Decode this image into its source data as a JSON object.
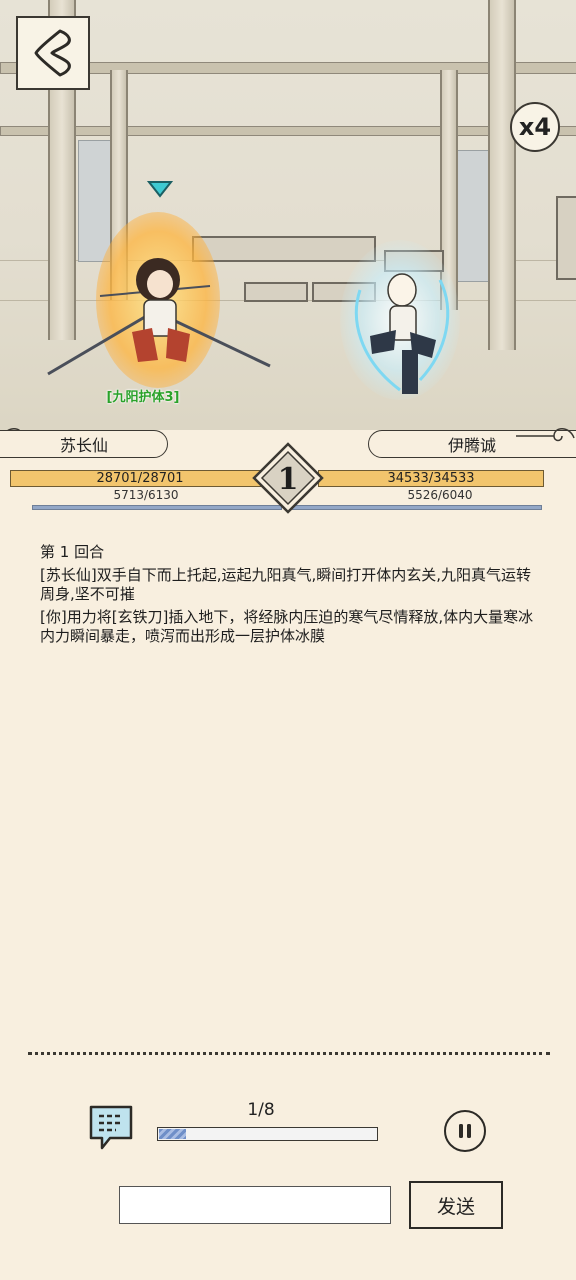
{
  "scene": {
    "speed_label": "x4",
    "player_buff": "[九阳护体3]"
  },
  "fighters": {
    "left": {
      "name": "苏长仙",
      "hp": "28701/28701",
      "mp": "5713/6130"
    },
    "right": {
      "name": "伊腾诚",
      "hp": "34533/34533",
      "mp": "5526/6040"
    }
  },
  "round_badge": "1",
  "log": {
    "round_title": "第 1 回合",
    "entries": [
      "[苏长仙]双手自下而上托起,运起九阳真气,瞬间打开体内玄关,九阳真气运转周身,坚不可摧",
      "[你]用力将[玄铁刀]插入地下，将经脉内压迫的寒气尽情释放,体内大量寒冰内力瞬间暴走，喷泻而出形成一层护体冰膜"
    ]
  },
  "controls": {
    "page_indicator": "1/8",
    "progress": 0.125,
    "chat_input_value": "",
    "chat_input_placeholder": "",
    "send_label": "发送"
  },
  "colors": {
    "background": "#f8efdf",
    "hp_bar": "#f2c56d",
    "mp_bar": "#93a7c7",
    "buff_text": "#2aa22a",
    "target_marker": "#3fc9d0"
  }
}
